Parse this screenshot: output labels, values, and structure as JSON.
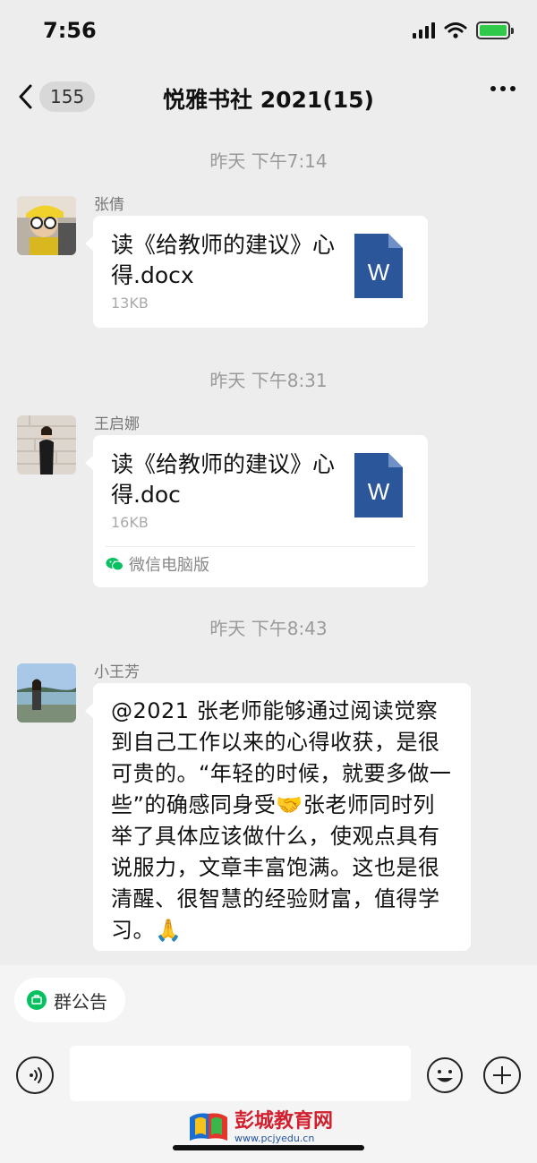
{
  "status_bar": {
    "time": "7:56"
  },
  "nav": {
    "back_count": "155",
    "title": "悦雅书社 2021(15)"
  },
  "messages": [
    {
      "timestamp": "昨天 下午7:14",
      "sender": "张倩",
      "file_name": "读《给教师的建议》心得.docx",
      "file_size": "13KB"
    },
    {
      "timestamp": "昨天 下午8:31",
      "sender": "王启娜",
      "file_name": "读《给教师的建议》心得.doc",
      "file_size": "16KB",
      "footer": "微信电脑版"
    },
    {
      "timestamp": "昨天 下午8:43",
      "sender": "小王芳",
      "text": "@2021 张老师能够通过阅读觉察到自己工作以来的心得收获，是很可贵的。“年轻的时候，就要多做一些”的确感同身受🤝张老师同时列举了具体应该做什么，使观点具有说服力，文章丰富饱满。这也是很清醒、很智慧的经验财富，值得学习。🙏"
    }
  ],
  "doc_icon_letter": "W",
  "announcement": {
    "label": "群公告"
  },
  "watermark": {
    "title": "彭城教育网",
    "url": "www.pcjyedu.cn"
  },
  "colors": {
    "doc_blue": "#2b579a",
    "bubble": "#ffffff",
    "background": "#ededed",
    "battery": "#30c94a",
    "wechat_green": "#07c160"
  },
  "icons": [
    "back-chevron-icon",
    "more-icon",
    "word-doc-icon",
    "wechat-icon",
    "announcement-icon",
    "voice-icon",
    "emoji-icon",
    "plus-icon"
  ]
}
